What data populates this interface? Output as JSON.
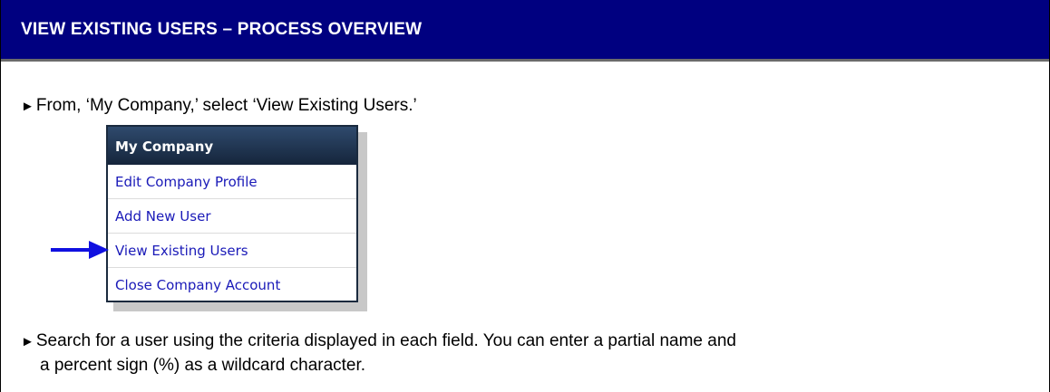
{
  "header": {
    "title": "VIEW EXISTING USERS – PROCESS OVERVIEW"
  },
  "steps": [
    {
      "marker": "►",
      "text": "From, ‘My Company,’ select ‘View Existing Users.’"
    },
    {
      "marker": "►",
      "text_line1": "Search for a user using the criteria displayed in each field. You can enter a partial name and",
      "text_line2": "a percent sign (%) as a wildcard character."
    }
  ],
  "menu": {
    "title": "My Company",
    "items": [
      {
        "label": "Edit Company Profile"
      },
      {
        "label": "Add New User"
      },
      {
        "label": "View Existing Users",
        "highlighted_by_arrow": true
      },
      {
        "label": "Close Company Account"
      }
    ]
  },
  "colors": {
    "header_bg": "#000080",
    "menu_header_bg": "#1c2e47",
    "menu_link": "#1a1ab8",
    "arrow": "#1010e0"
  },
  "icons": {
    "pointer_arrow": "right-arrow-icon"
  }
}
